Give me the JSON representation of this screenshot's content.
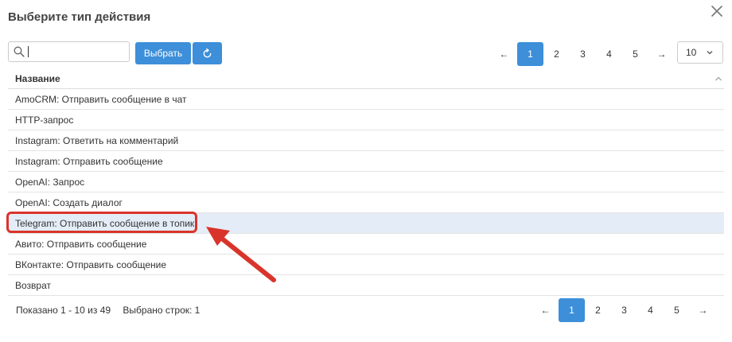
{
  "dialog": {
    "title": "Выберите тип действия"
  },
  "toolbar": {
    "search_value": "",
    "select_label": "Выбрать"
  },
  "pagination": {
    "prev": "←",
    "next": "→",
    "pages": [
      "1",
      "2",
      "3",
      "4",
      "5"
    ],
    "current_page": "1",
    "page_size": "10"
  },
  "table": {
    "header": "Название",
    "rows": [
      "AmoCRM: Отправить сообщение в чат",
      "HTTP-запрос",
      "Instagram: Ответить на комментарий",
      "Instagram: Отправить сообщение",
      "OpenAI: Запрос",
      "OpenAI: Создать диалог",
      "Telegram: Отправить сообщение в топик",
      "Авито: Отправить сообщение",
      "ВКонтакте: Отправить сообщение",
      "Возврат"
    ],
    "selected_row_index": 6
  },
  "footer": {
    "shown": "Показано 1 - 10 из 49",
    "selected": "Выбрано строк: 1"
  },
  "icons": {
    "close": "close-icon",
    "search": "search-icon",
    "refresh": "refresh-icon",
    "sort": "chevron-up-icon",
    "dropdown": "chevron-down-icon"
  },
  "colors": {
    "primary": "#3d8fd9",
    "selected_row": "#e4edf7",
    "annotation": "#d9342b"
  }
}
